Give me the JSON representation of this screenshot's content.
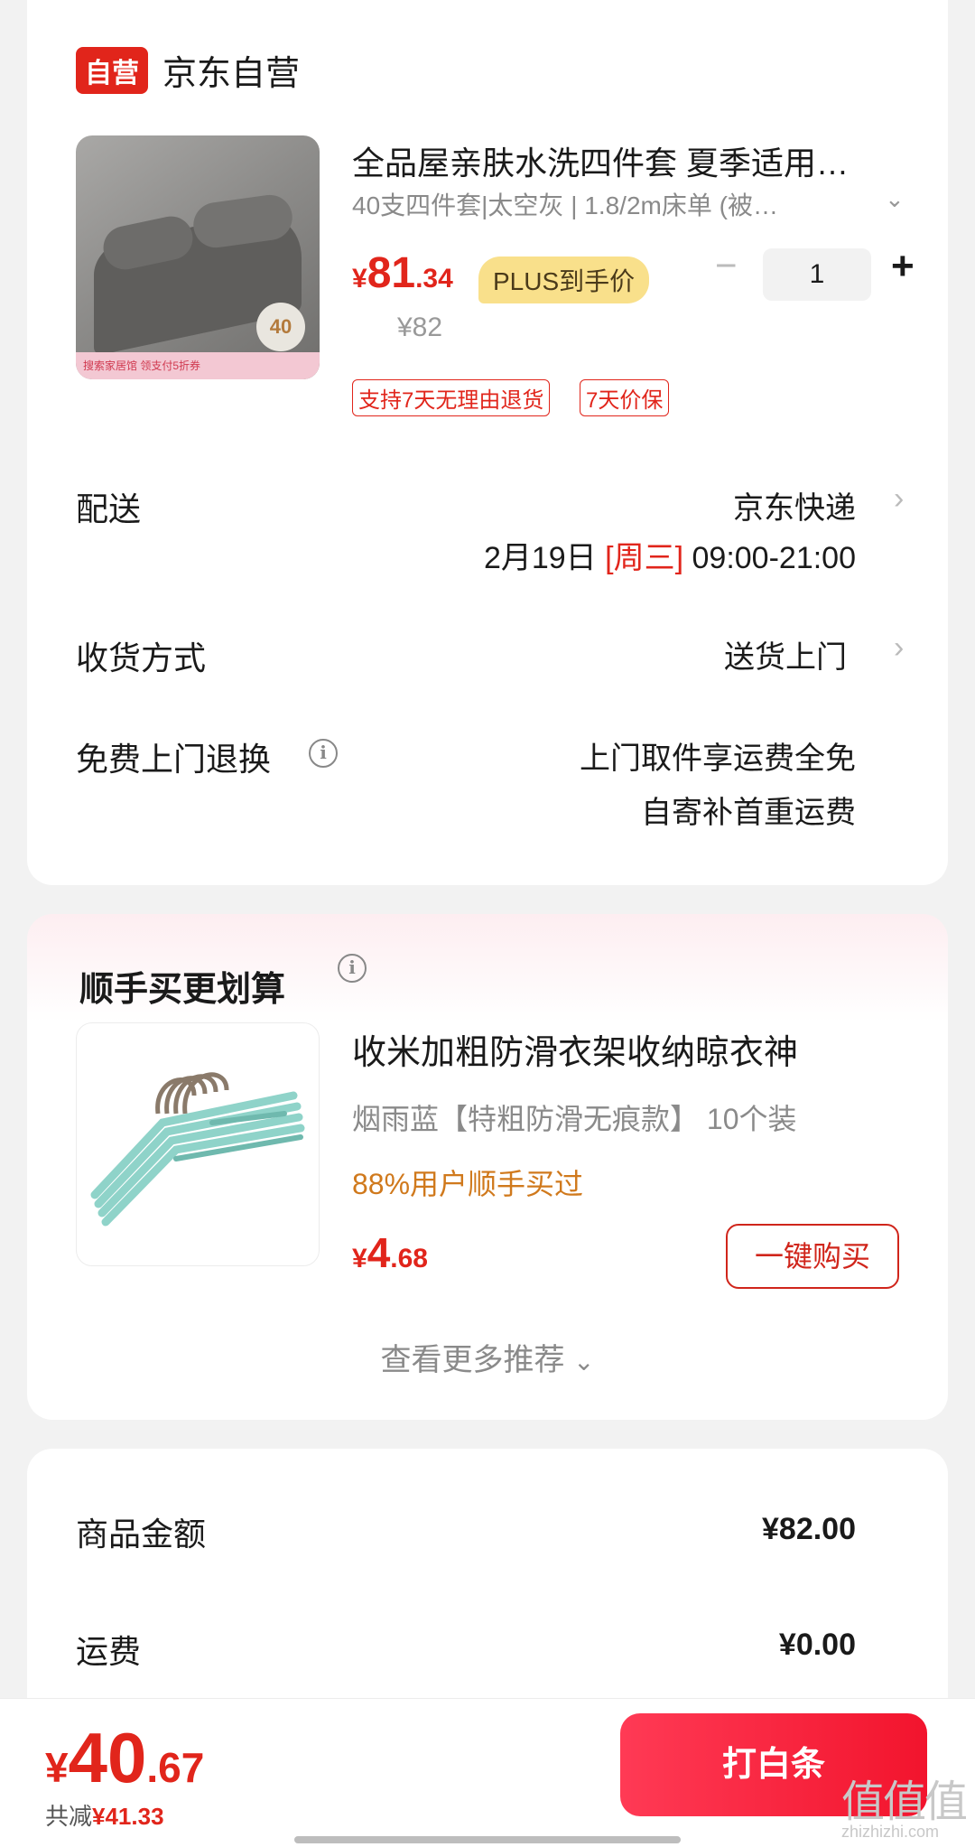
{
  "store": {
    "badge": "自营",
    "name": "京东自营"
  },
  "product": {
    "title": "全品屋亲肤水洗四件套 夏季适用…",
    "spec": "40支四件套|太空灰 | 1.8/2m床单 (被…",
    "price_currency": "¥",
    "price_int": "81",
    "price_dec": ".34",
    "plus_tag": "PLUS到手价",
    "original_price": "¥82",
    "quantity": "1",
    "minus": "−",
    "plus": "+",
    "tags": [
      "支持7天无理由退货",
      "7天价保"
    ],
    "image": {
      "badge": "40",
      "strip": "搜索家居馆 领支付5折券"
    }
  },
  "delivery": {
    "label": "配送",
    "carrier": "京东快递",
    "date": "2月19日",
    "weekday": "[周三]",
    "time": "09:00-21:00"
  },
  "receive": {
    "label": "收货方式",
    "value": "送货上门"
  },
  "return_exchange": {
    "label": "免费上门退换",
    "line1": "上门取件享运费全免",
    "line2": "自寄补首重运费"
  },
  "recommend": {
    "title": "顺手买更划算",
    "item": {
      "name": "收米加粗防滑衣架收纳晾衣神",
      "spec": "烟雨蓝【特粗防滑无痕款】  10个装",
      "percent": "88%用户顺手买过",
      "price_currency": "¥",
      "price_int": "4",
      "price_dec": ".68",
      "buy_label": "一键购买"
    },
    "more_label": "查看更多推荐"
  },
  "summary": {
    "goods_label": "商品金额",
    "goods_value": "¥82.00",
    "shipping_label": "运费",
    "shipping_value": "¥0.00"
  },
  "footer": {
    "total_currency": "¥",
    "total_int": "40",
    "total_dec": ".67",
    "saving_label": "共减",
    "saving_value": "¥41.33",
    "pay_label": "打白条"
  },
  "watermark": {
    "main": "值值值",
    "sub": "zhizhizhi.com"
  },
  "colors": {
    "accent": "#e1251b",
    "plus_gold": "#f9e08b",
    "percent_orange": "#d0791c"
  }
}
